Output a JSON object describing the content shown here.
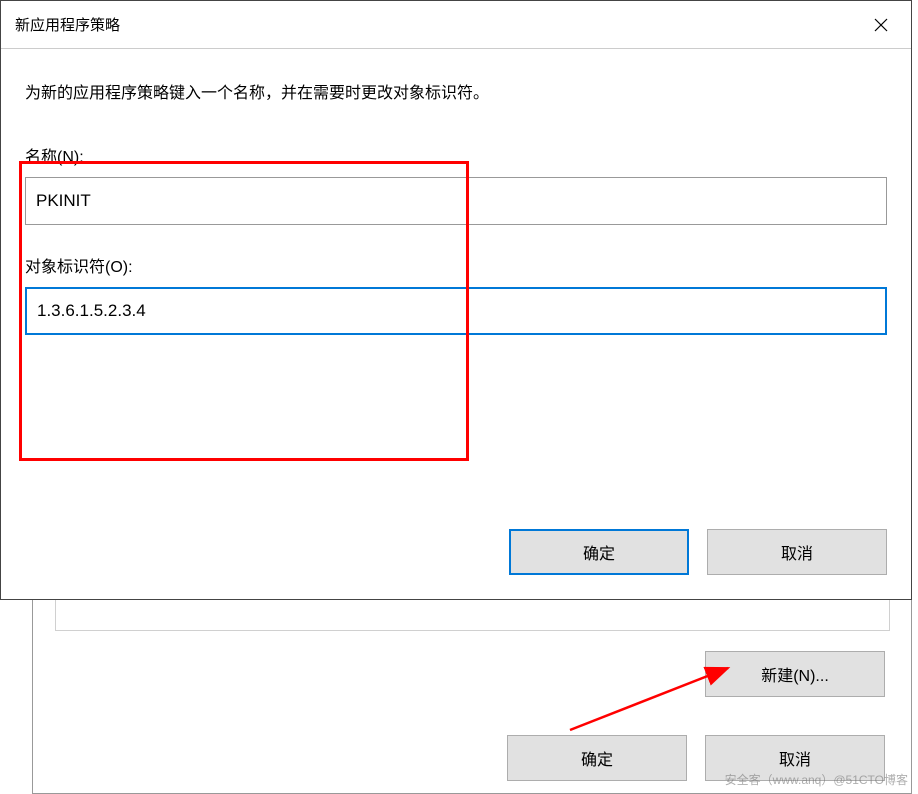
{
  "modal": {
    "title": "新应用程序策略",
    "instruction": "为新的应用程序策略键入一个名称，并在需要时更改对象标识符。",
    "name_label": "名称(N):",
    "name_value": "PKINIT",
    "oid_label": "对象标识符(O):",
    "oid_value": "1.3.6.1.5.2.3.4",
    "ok_label": "确定",
    "cancel_label": "取消"
  },
  "outer": {
    "new_label": "新建(N)...",
    "ok_label": "确定",
    "cancel_label": "取消"
  },
  "watermark": "安全客（www.anq）@51CTO博客"
}
